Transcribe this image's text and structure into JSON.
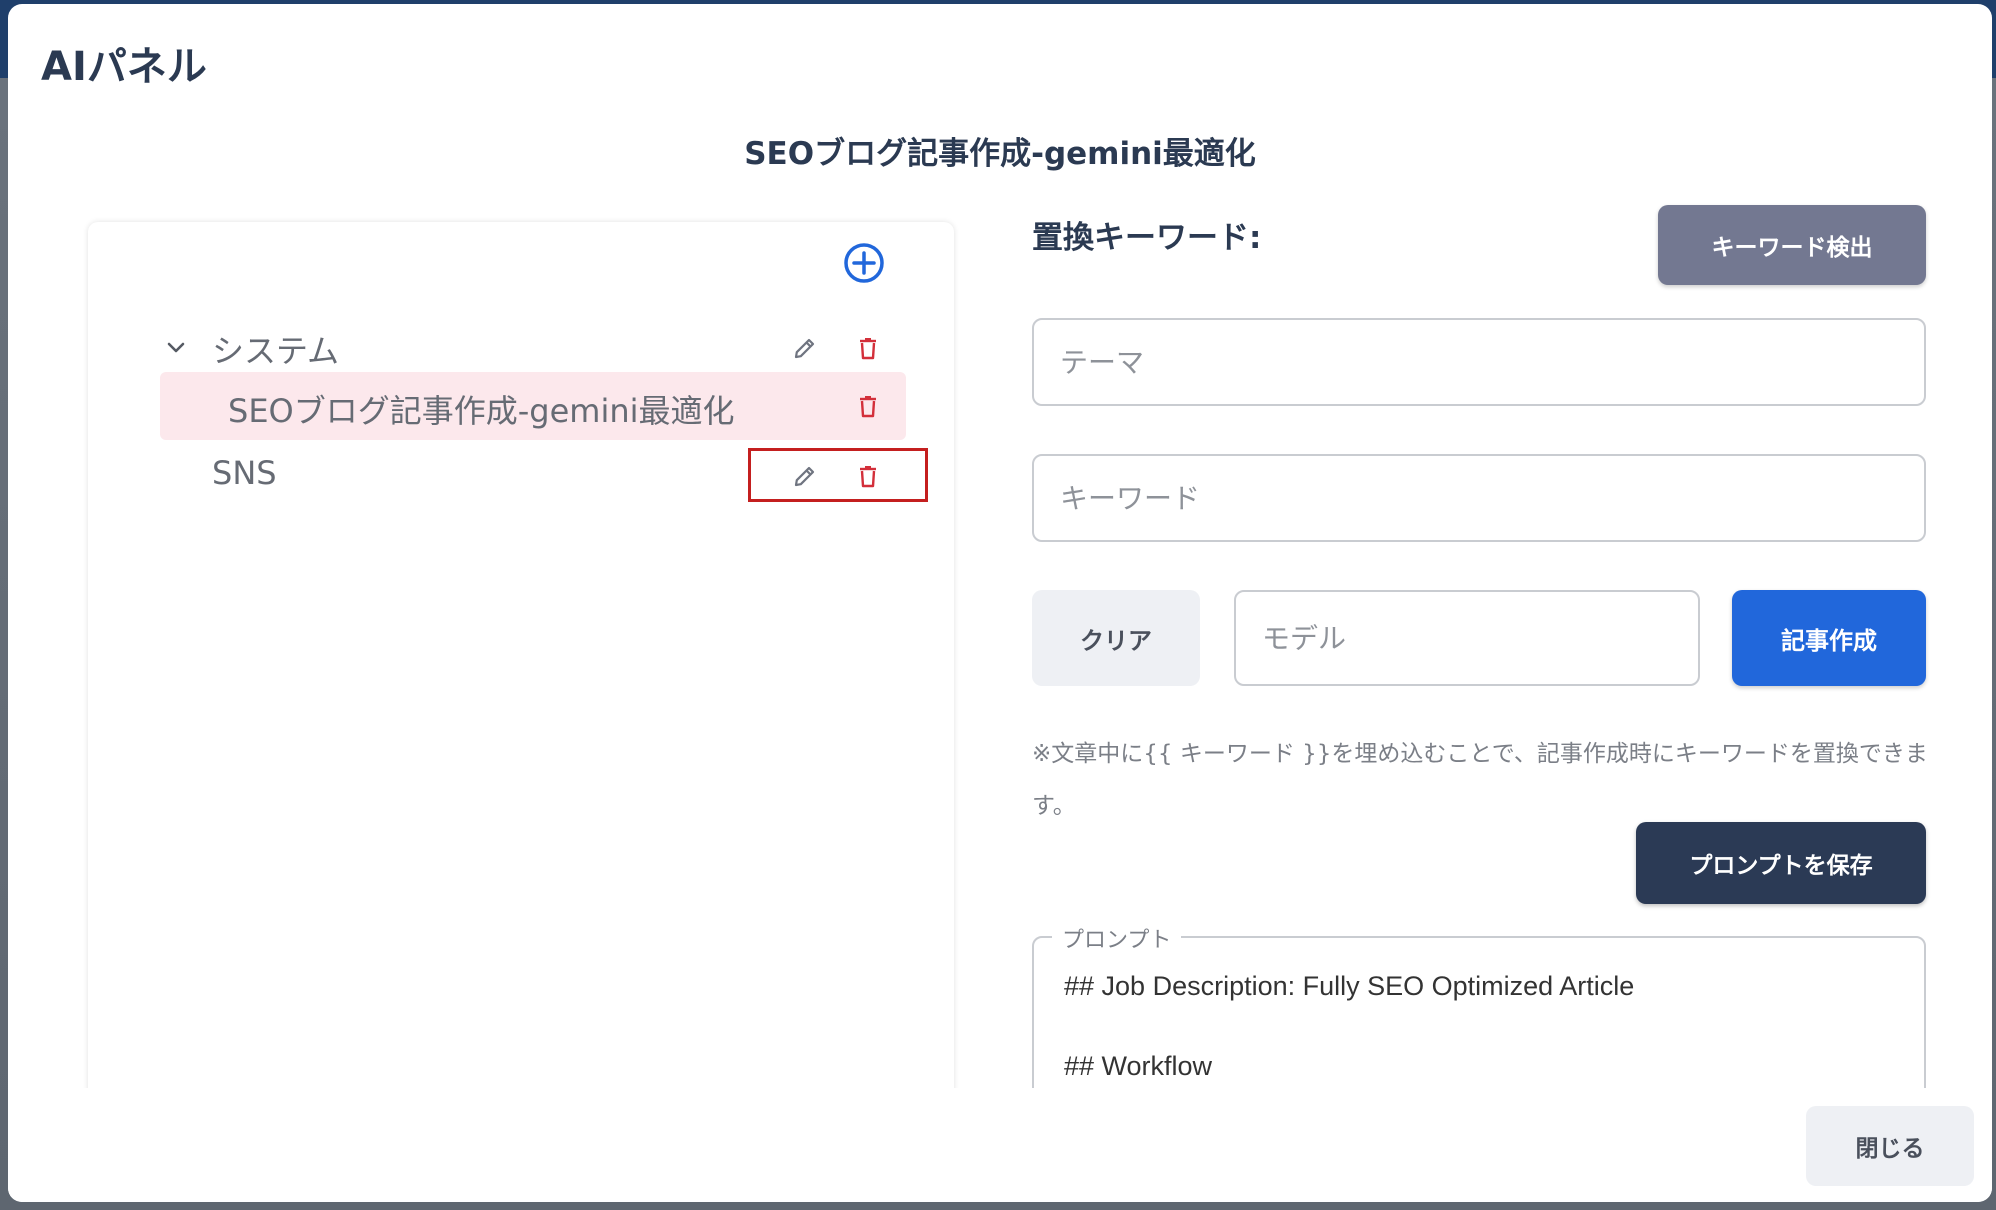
{
  "modal": {
    "title": "AIパネル",
    "prompt_heading": "SEOブログ記事作成-gemini最適化"
  },
  "tree": {
    "groups": [
      {
        "label": "システム",
        "expanded": true,
        "children": [
          {
            "label": "SEOブログ記事作成-gemini最適化",
            "selected": true
          }
        ]
      },
      {
        "label": "SNS"
      }
    ]
  },
  "replace": {
    "label": "置換キーワード:",
    "detect_button": "キーワード検出",
    "theme_placeholder": "テーマ",
    "keyword_placeholder": "キーワード",
    "clear_button": "クリア",
    "model_placeholder": "モデル",
    "create_button": "記事作成",
    "note": "※文章中に{{ キーワード }}を埋め込むことで、記事作成時にキーワードを置換できます。"
  },
  "prompt": {
    "save_button": "プロンプトを保存",
    "legend": "プロンプト",
    "text": "## Job Description: Fully SEO Optimized Article\n\n## Workflow\n### 最初のステップ"
  },
  "footer": {
    "close_button": "閉じる"
  },
  "colors": {
    "primary": "#2167db",
    "dark": "#2b3a55",
    "muted_button": "#737891",
    "danger": "#d32f3a",
    "selected_row": "#fce8ec"
  }
}
